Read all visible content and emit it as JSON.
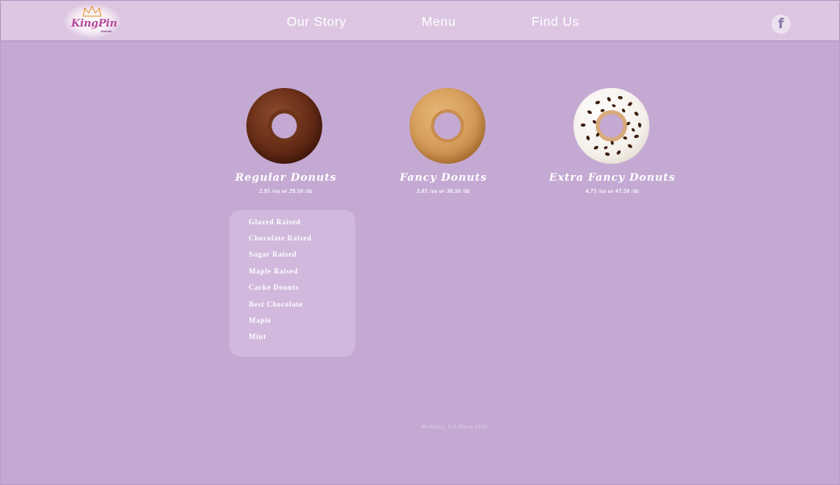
{
  "brand": {
    "logo_text": "KingPin",
    "logo_sub": "donuts"
  },
  "nav": {
    "items": [
      "Our Story",
      "Menu",
      "Find Us"
    ],
    "social": "f"
  },
  "categories": [
    {
      "title": "Regular Donuts",
      "price": "2.95 /ea or 29.50 /dz",
      "image": "chocolate-donut"
    },
    {
      "title": "Fancy Donuts",
      "price": "3.85 /ea or 38.50 /dz",
      "image": "glazed-donut"
    },
    {
      "title": "Extra Fancy Donuts",
      "price": "4.75 /ea or 47.50 /dz",
      "image": "sprinkle-donut"
    }
  ],
  "dropdown": {
    "items": [
      "Glazed Raised",
      "Chocolate Raised",
      "Sugar Raised",
      "Maple Raised",
      "Cacke Donuts",
      "Best Chocolate",
      "Maple",
      "Mint"
    ]
  },
  "footer": {
    "text": "Berkeley, CA Since 1939"
  },
  "colors": {
    "background": "#c4a9d3",
    "header": "#dcc6e1",
    "dropdown": "#d0b9dc",
    "text": "#ffffff"
  }
}
